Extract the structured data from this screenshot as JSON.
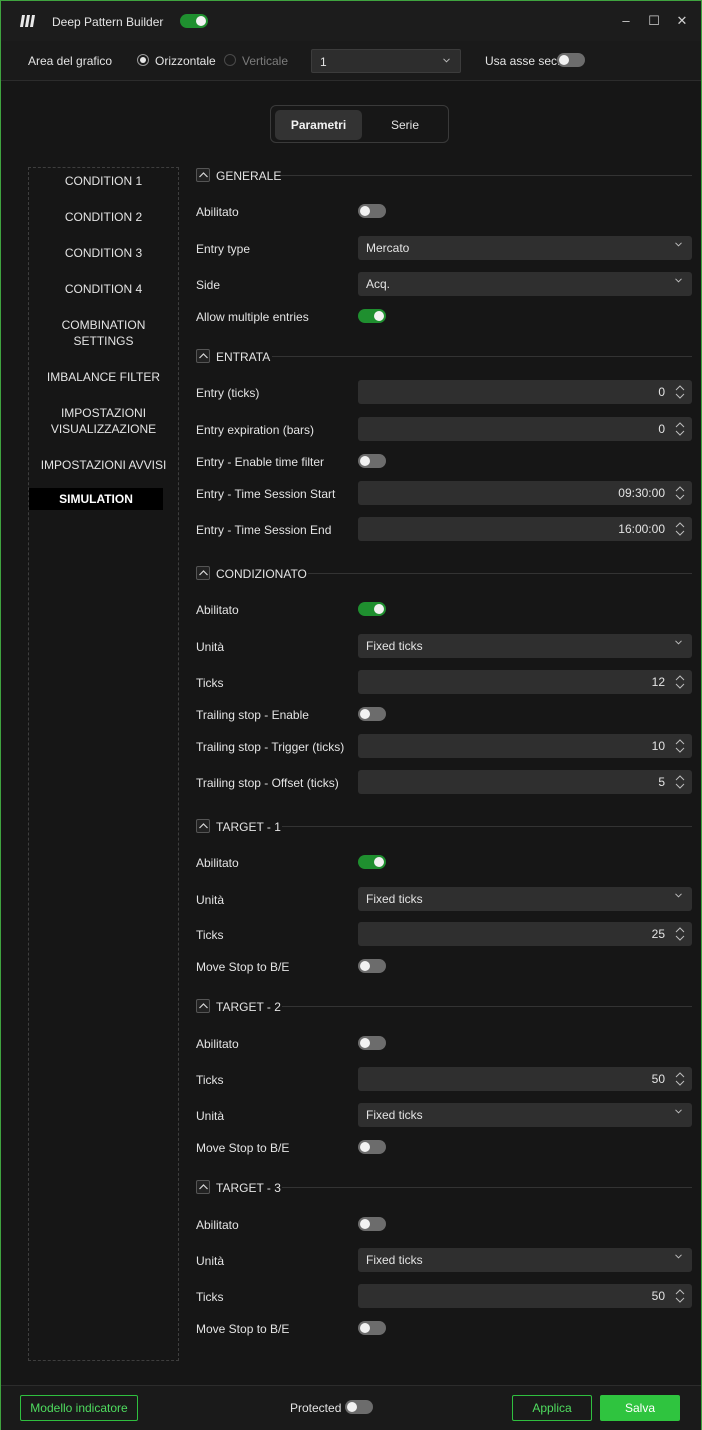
{
  "window": {
    "title": "Deep Pattern Builder",
    "controls": {
      "minimize": "–",
      "maximize": "☐",
      "close": "✕"
    }
  },
  "toolbar": {
    "area_label": "Area del grafico",
    "orientation": {
      "horizontal": "Orizzontale",
      "vertical": "Verticale",
      "selected": "horizontal"
    },
    "area_value": "1",
    "secondary_axis_label": "Usa asse sec."
  },
  "tabs": [
    {
      "label": "Parametri",
      "active": true
    },
    {
      "label": "Serie",
      "active": false
    }
  ],
  "nav": [
    "CONDITION 1",
    "CONDITION 2",
    "CONDITION 3",
    "CONDITION 4",
    "COMBINATION SETTINGS",
    "IMBALANCE FILTER",
    "IMPOSTAZIONI VISUALIZZAZIONE",
    "IMPOSTAZIONI AVVISI",
    "SIMULATION"
  ],
  "nav_active": "SIMULATION",
  "sections": {
    "generale": {
      "title": "GENERALE",
      "enabled_label": "Abilitato",
      "enabled": false,
      "entry_type_label": "Entry type",
      "entry_type": "Mercato",
      "side_label": "Side",
      "side": "Acq.",
      "multiple_label": "Allow multiple entries",
      "multiple": true
    },
    "entrata": {
      "title": "ENTRATA",
      "entry_ticks_label": "Entry (ticks)",
      "entry_ticks": "0",
      "expiration_label": "Entry expiration (bars)",
      "expiration": "0",
      "time_filter_label": "Entry - Enable time filter",
      "time_filter": false,
      "session_start_label": "Entry - Time Session Start",
      "session_start": "09:30:00",
      "session_end_label": "Entry - Time Session End",
      "session_end": "16:00:00"
    },
    "condizionato": {
      "title": "CONDIZIONATO",
      "enabled_label": "Abilitato",
      "enabled": true,
      "unit_label": "Unità",
      "unit": "Fixed ticks",
      "ticks_label": "Ticks",
      "ticks": "12",
      "trailing_enable_label": "Trailing stop - Enable",
      "trailing_enable": false,
      "trailing_trigger_label": "Trailing stop - Trigger (ticks)",
      "trailing_trigger": "10",
      "trailing_offset_label": "Trailing stop - Offset (ticks)",
      "trailing_offset": "5"
    },
    "target1": {
      "title": "TARGET - 1",
      "enabled_label": "Abilitato",
      "enabled": true,
      "unit_label": "Unità",
      "unit": "Fixed ticks",
      "ticks_label": "Ticks",
      "ticks": "25",
      "move_stop_label": "Move Stop to B/E",
      "move_stop": false
    },
    "target2": {
      "title": "TARGET - 2",
      "enabled_label": "Abilitato",
      "enabled": false,
      "ticks_label": "Ticks",
      "ticks": "50",
      "unit_label": "Unità",
      "unit": "Fixed ticks",
      "move_stop_label": "Move Stop to B/E",
      "move_stop": false
    },
    "target3": {
      "title": "TARGET - 3",
      "enabled_label": "Abilitato",
      "enabled": false,
      "unit_label": "Unità",
      "unit": "Fixed ticks",
      "ticks_label": "Ticks",
      "ticks": "50",
      "move_stop_label": "Move Stop to B/E",
      "move_stop": false
    }
  },
  "footer": {
    "template_button": "Modello indicatore",
    "protected_label": "Protected",
    "apply_button": "Applica",
    "save_button": "Salva"
  },
  "colors": {
    "accent": "#2fc43f",
    "toggle_on": "#1f8f2f",
    "window_border": "#3fa33f",
    "background": "#161616"
  }
}
